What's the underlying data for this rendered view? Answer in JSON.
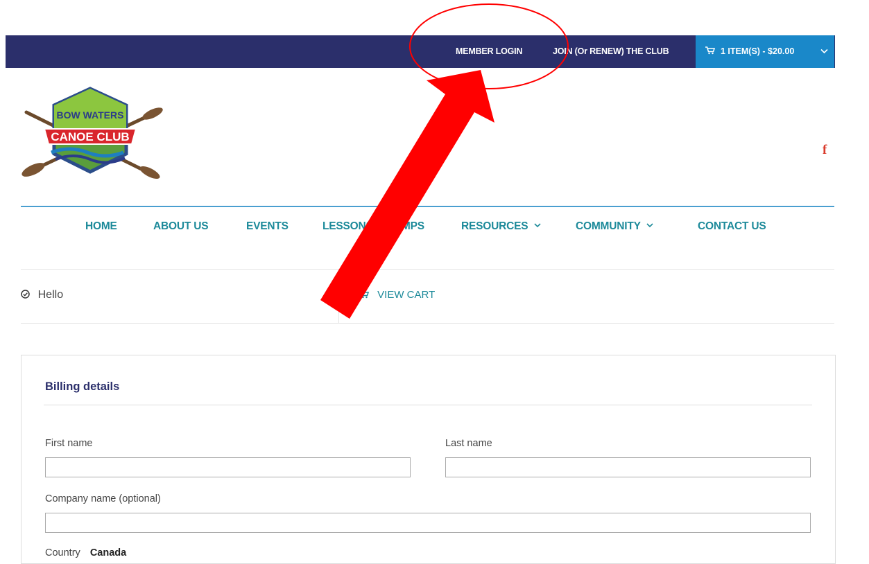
{
  "topbar": {
    "member_login": "MEMBER LOGIN",
    "join_club": "JOIN (Or RENEW) THE CLUB",
    "cart_summary": "1 ITEM(S) - $20.00"
  },
  "logo": {
    "line1": "BOW WATERS",
    "line2": "CANOE CLUB"
  },
  "social": {
    "facebook": "f"
  },
  "nav": {
    "home": "HOME",
    "about": "ABOUT US",
    "events": "EVENTS",
    "lessons": "LESSONS & CAMPS",
    "resources": "RESOURCES",
    "community": "COMMUNITY",
    "contact": "CONTACT US"
  },
  "notice": {
    "hello": "Hello",
    "view_cart": "VIEW CART"
  },
  "billing": {
    "title": "Billing details",
    "first_name_label": "First name",
    "last_name_label": "Last name",
    "company_label": "Company name (optional)",
    "first_name_value": "",
    "last_name_value": "",
    "company_value": "",
    "country_label": "Country",
    "country_value": "Canada"
  },
  "colors": {
    "topbar": "#2b2f6b",
    "cart_button": "#1a88c9",
    "nav_text": "#1d8a9a",
    "annotation": "#ff0000"
  },
  "icons": [
    "cart-icon",
    "chevron-down-icon",
    "facebook-icon",
    "check-circle-icon",
    "annotation-arrow",
    "annotation-ellipse"
  ]
}
